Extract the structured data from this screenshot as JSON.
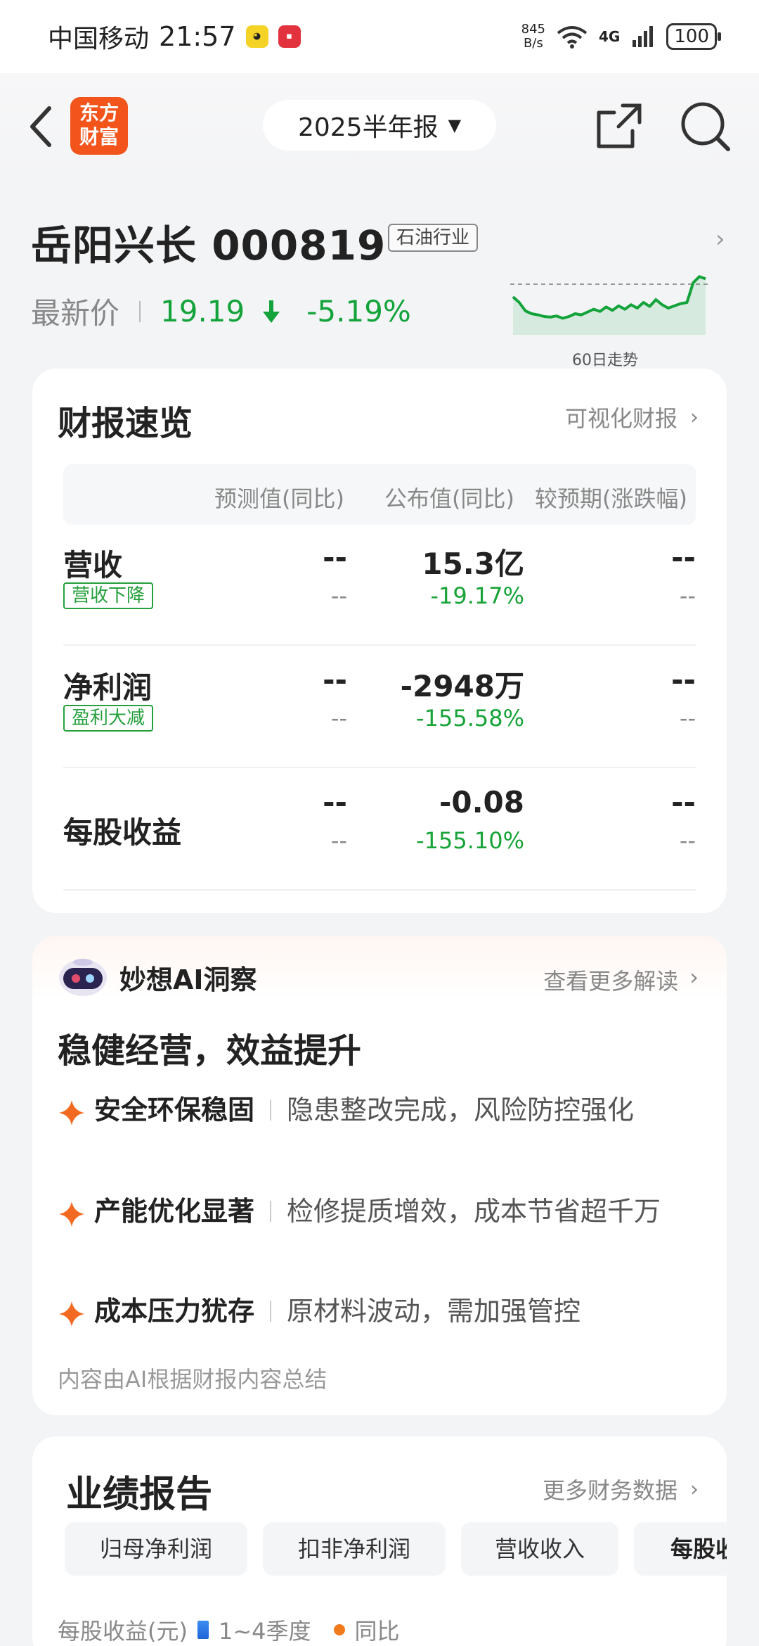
{
  "status_bar": {
    "carrier": "中国移动",
    "time": "21:57",
    "net_speed": "845",
    "net_speed_unit": "B/s",
    "network": "4G",
    "battery": "100"
  },
  "header": {
    "logo_text_1": "东方",
    "logo_text_2": "财富",
    "period": "2025半年报"
  },
  "stock": {
    "name_code": "岳阳兴长  000819",
    "industry": "石油行业",
    "price_label": "最新价",
    "price": "19.19",
    "change_pct": "-5.19%",
    "trend_label": "60日走势",
    "trend_points": [
      0.6,
      0.5,
      0.35,
      0.3,
      0.28,
      0.25,
      0.24,
      0.26,
      0.22,
      0.25,
      0.3,
      0.28,
      0.33,
      0.38,
      0.34,
      0.42,
      0.36,
      0.44,
      0.38,
      0.46,
      0.4,
      0.5,
      0.43,
      0.55,
      0.46,
      0.4,
      0.44,
      0.48,
      0.5,
      0.85,
      0.96,
      0.92
    ]
  },
  "summary": {
    "title": "财报速览",
    "link": "可视化财报",
    "columns": [
      "预测值(同比)",
      "公布值(同比)",
      "较预期(涨跌幅)"
    ],
    "rows": [
      {
        "name": "营收",
        "tag": "营收下降",
        "forecast": "--",
        "forecast_sub": "--",
        "actual": "15.3亿",
        "actual_sub": "-19.17%",
        "vs": "--",
        "vs_sub": "--"
      },
      {
        "name": "净利润",
        "tag": "盈利大减",
        "forecast": "--",
        "forecast_sub": "--",
        "actual": "-2948万",
        "actual_sub": "-155.58%",
        "vs": "--",
        "vs_sub": "--"
      },
      {
        "name": "每股收益",
        "tag": "",
        "forecast": "--",
        "forecast_sub": "--",
        "actual": "-0.08",
        "actual_sub": "-155.10%",
        "vs": "--",
        "vs_sub": "--"
      }
    ]
  },
  "ai": {
    "title": "妙想AI洞察",
    "link": "查看更多解读",
    "headline": "稳健经营，效益提升",
    "bullets": [
      {
        "title": "安全环保稳固",
        "desc": "隐患整改完成，风险防控强化"
      },
      {
        "title": "产能优化显著",
        "desc": "检修提质增效，成本节省超千万"
      },
      {
        "title": "成本压力犹存",
        "desc": "原材料波动，需加强管控"
      }
    ],
    "note": "内容由AI根据财报内容总结"
  },
  "performance": {
    "title": "业绩报告",
    "link": "更多财务数据",
    "tabs": [
      "归母净利润",
      "扣非净利润",
      "营收收入",
      "每股收"
    ],
    "legend_unit": "每股收益(元)",
    "legend_series_1": "1~4季度",
    "legend_series_2": "同比"
  },
  "colors": {
    "down_green": "#13a33a",
    "logo_orange": "#f2541b",
    "star_orange": "#f26a21",
    "series_blue": "#1e64d6",
    "series_orange": "#f07a1c"
  }
}
